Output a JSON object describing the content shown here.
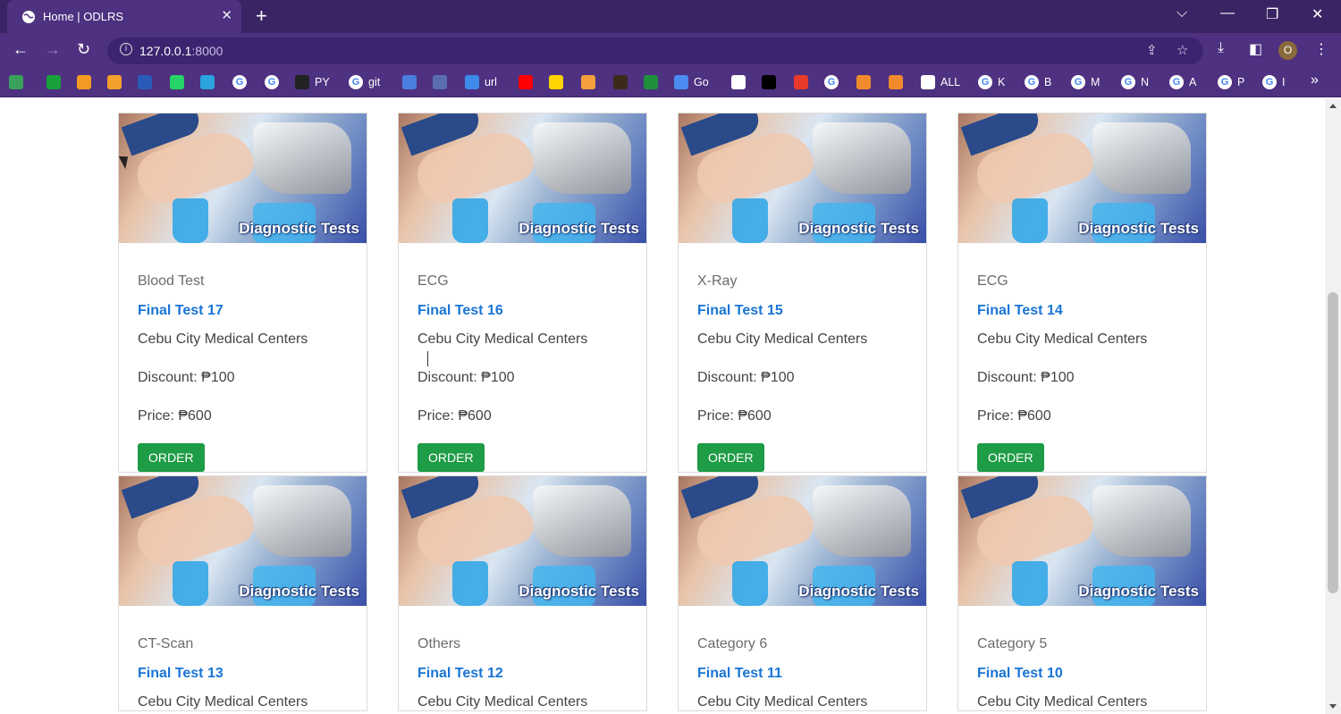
{
  "browser": {
    "tab_title": "Home | ODLRS",
    "new_tab_label": "+",
    "tab_close": "✕",
    "url_host": "127.0.0.1",
    "url_port": ":8000",
    "profile_initial": "O",
    "window_controls": {
      "dropdown": "⌵",
      "minimize": "—",
      "restore": "❐",
      "close": "✕"
    }
  },
  "bookmarks": [
    {
      "icon": "bookmark-icon-green",
      "label": "",
      "color": "#3aa15a"
    },
    {
      "icon": "bookmark-icon-cross",
      "label": "",
      "color": "#18a03c"
    },
    {
      "icon": "bookmark-icon-orange",
      "label": "",
      "color": "#f59a23"
    },
    {
      "icon": "bookmark-icon-chart",
      "label": "",
      "color": "#f4a02c"
    },
    {
      "icon": "ieee-icon",
      "label": "",
      "color": "#2a5bb8"
    },
    {
      "icon": "whatsapp-icon",
      "label": "",
      "color": "#25d366"
    },
    {
      "icon": "telegram-icon",
      "label": "",
      "color": "#2aa3df"
    },
    {
      "icon": "google-icon",
      "label": "",
      "color": "#ffffff"
    },
    {
      "icon": "google-icon",
      "label": "",
      "color": "#ffffff"
    },
    {
      "icon": "github-icon",
      "label": "PY",
      "color": "#222222"
    },
    {
      "icon": "google-icon",
      "label": "git",
      "color": "#ffffff"
    },
    {
      "icon": "bookmark-icon-blue",
      "label": "",
      "color": "#4a7de0"
    },
    {
      "icon": "bookmark-icon-calendar",
      "label": "",
      "color": "#5a6db0"
    },
    {
      "icon": "bookmark-icon-url",
      "label": "url",
      "color": "#3d8ae8"
    },
    {
      "icon": "youtube-icon",
      "label": "",
      "color": "#ff0000"
    },
    {
      "icon": "bookmark-icon-p",
      "label": "",
      "color": "#ffd400"
    },
    {
      "icon": "bookmark-icon-cam",
      "label": "",
      "color": "#f3a03c"
    },
    {
      "icon": "bookmark-icon-dark",
      "label": "",
      "color": "#3b2a1a"
    },
    {
      "icon": "bookmark-icon-ring",
      "label": "",
      "color": "#1f8f3c"
    },
    {
      "icon": "bookmark-icon-go",
      "label": "Go",
      "color": "#4a8cf0"
    },
    {
      "icon": "bookmark-icon-doc",
      "label": "",
      "color": "#ffffff"
    },
    {
      "icon": "bookmark-icon-cl",
      "label": "",
      "color": "#000000"
    },
    {
      "icon": "yandex-icon",
      "label": "",
      "color": "#e8392b"
    },
    {
      "icon": "google-icon",
      "label": "",
      "color": "#ffffff"
    },
    {
      "icon": "bookmark-icon-bird",
      "label": "",
      "color": "#f08a2c"
    },
    {
      "icon": "bookmark-icon-eye",
      "label": "",
      "color": "#f08a2c"
    },
    {
      "icon": "globe-icon",
      "label": "ALL",
      "color": "#ffffff"
    },
    {
      "icon": "google-icon",
      "label": "K",
      "color": "#ffffff"
    },
    {
      "icon": "google-icon",
      "label": "B",
      "color": "#ffffff"
    },
    {
      "icon": "google-icon",
      "label": "M",
      "color": "#ffffff"
    },
    {
      "icon": "google-icon",
      "label": "N",
      "color": "#ffffff"
    },
    {
      "icon": "google-icon",
      "label": "A",
      "color": "#ffffff"
    },
    {
      "icon": "google-icon",
      "label": "P",
      "color": "#ffffff"
    },
    {
      "icon": "google-icon",
      "label": "I",
      "color": "#ffffff"
    }
  ],
  "cards": [
    {
      "category": "Blood Test",
      "name": "Final Test 17",
      "center": "Cebu City Medical Centers",
      "discount": "Discount: ₱100",
      "price": "Price: ₱600",
      "button": "ORDER",
      "image_label": "Diagnostic Tests"
    },
    {
      "category": "ECG",
      "name": "Final Test 16",
      "center": "Cebu City Medical Centers",
      "discount": "Discount: ₱100",
      "price": "Price: ₱600",
      "button": "ORDER",
      "image_label": "Diagnostic Tests"
    },
    {
      "category": "X-Ray",
      "name": "Final Test 15",
      "center": "Cebu City Medical Centers",
      "discount": "Discount: ₱100",
      "price": "Price: ₱600",
      "button": "ORDER",
      "image_label": "Diagnostic Tests"
    },
    {
      "category": "ECG",
      "name": "Final Test 14",
      "center": "Cebu City Medical Centers",
      "discount": "Discount: ₱100",
      "price": "Price: ₱600",
      "button": "ORDER",
      "image_label": "Diagnostic Tests"
    },
    {
      "category": "CT-Scan",
      "name": "Final Test 13",
      "center": "Cebu City Medical Centers",
      "discount": "",
      "price": "",
      "button": "",
      "image_label": "Diagnostic Tests"
    },
    {
      "category": "Others",
      "name": "Final Test 12",
      "center": "Cebu City Medical Centers",
      "discount": "",
      "price": "",
      "button": "",
      "image_label": "Diagnostic Tests"
    },
    {
      "category": "Category 6",
      "name": "Final Test 11",
      "center": "Cebu City Medical Centers",
      "discount": "",
      "price": "",
      "button": "",
      "image_label": "Diagnostic Tests"
    },
    {
      "category": "Category 5",
      "name": "Final Test 10",
      "center": "Cebu City Medical Centers",
      "discount": "",
      "price": "",
      "button": "",
      "image_label": "Diagnostic Tests"
    }
  ],
  "colors": {
    "chrome": "#4e3180",
    "tabstrip": "#3b2464",
    "link": "#1a75d6",
    "order_button": "#1e9c46"
  }
}
